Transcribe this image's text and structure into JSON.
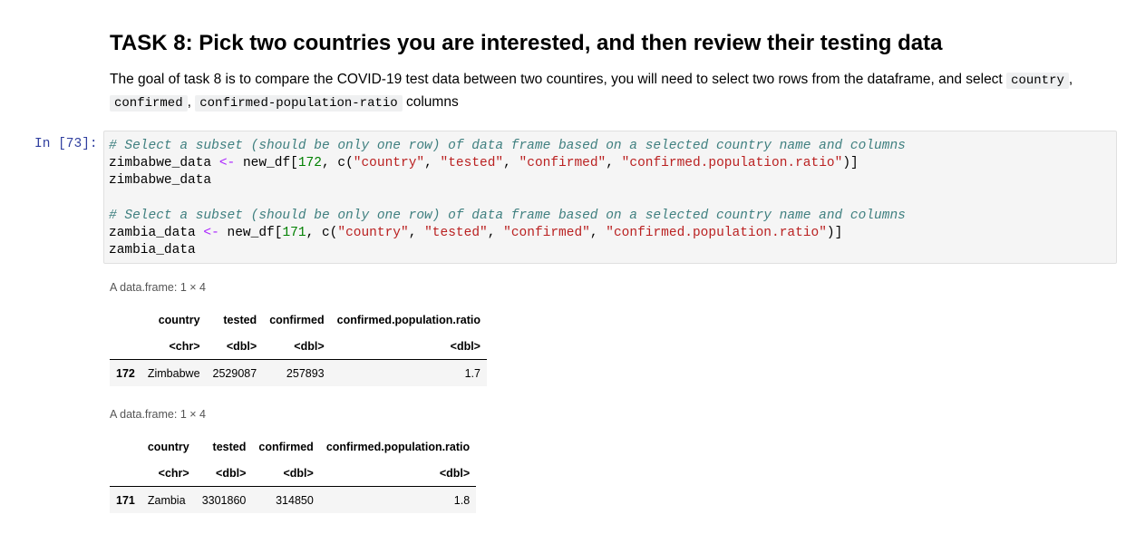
{
  "markdown": {
    "heading": "TASK 8: Pick two countries you are interested, and then review their testing data",
    "para_text_1": "The goal of task 8 is to compare the COVID-19 test data between two countires, you will need to select two rows from the dataframe, and select ",
    "code_country": "country",
    "sep_1": ",",
    "code_confirmed": "confirmed",
    "sep_2": ",",
    "code_ratio": "confirmed-population-ratio",
    "para_text_2": " columns"
  },
  "cell": {
    "prompt": "In [73]:",
    "line1_comment": "# Select a subset (should be only one row) of data frame based on a selected country name and columns",
    "line2_var": "zimbabwe_data",
    "line2_op": "<-",
    "line2_call": "new_df[",
    "line2_num": "172",
    "line2_mid": ", c(",
    "line2_s1": "\"country\"",
    "line2_s2": "\"tested\"",
    "line2_s3": "\"confirmed\"",
    "line2_s4": "\"confirmed.population.ratio\"",
    "line2_end": ")]",
    "line3": "zimbabwe_data",
    "line5_comment": "# Select a subset (should be only one row) of data frame based on a selected country name and columns",
    "line6_var": "zambia_data",
    "line6_op": "<-",
    "line6_call": "new_df[",
    "line6_num": "171",
    "line6_mid": ", c(",
    "line6_s1": "\"country\"",
    "line6_s2": "\"tested\"",
    "line6_s3": "\"confirmed\"",
    "line6_s4": "\"confirmed.population.ratio\"",
    "line6_end": ")]",
    "line7": "zambia_data",
    "comma": ", "
  },
  "outputs": [
    {
      "caption": "A data.frame: 1 × 4",
      "headers": [
        "country",
        "tested",
        "confirmed",
        "confirmed.population.ratio"
      ],
      "types": [
        "<chr>",
        "<dbl>",
        "<dbl>",
        "<dbl>"
      ],
      "row_index": "172",
      "row": [
        "Zimbabwe",
        "2529087",
        "257893",
        "1.7"
      ]
    },
    {
      "caption": "A data.frame: 1 × 4",
      "headers": [
        "country",
        "tested",
        "confirmed",
        "confirmed.population.ratio"
      ],
      "types": [
        "<chr>",
        "<dbl>",
        "<dbl>",
        "<dbl>"
      ],
      "row_index": "171",
      "row": [
        "Zambia",
        "3301860",
        "314850",
        "1.8"
      ]
    }
  ]
}
